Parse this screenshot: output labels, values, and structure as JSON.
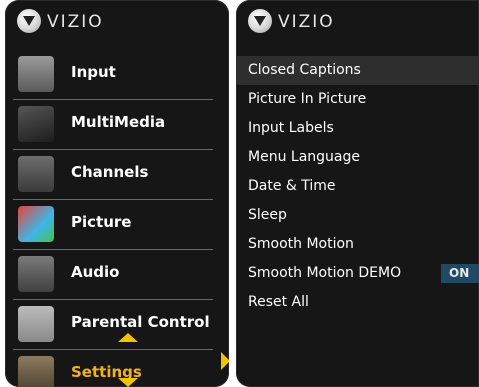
{
  "left_panel": {
    "brand": "VIZIO",
    "menu": [
      {
        "label": "Input",
        "icon": "input-icon"
      },
      {
        "label": "MultiMedia",
        "icon": "usb-stick-icon"
      },
      {
        "label": "Channels",
        "icon": "antenna-icon"
      },
      {
        "label": "Picture",
        "icon": "picture-tv-icon"
      },
      {
        "label": "Audio",
        "icon": "speaker-icon"
      },
      {
        "label": "Parental Control",
        "icon": "family-icon"
      },
      {
        "label": "Settings",
        "icon": "settings-icon"
      }
    ],
    "active_item": "Settings"
  },
  "right_panel": {
    "brand": "VIZIO",
    "items": [
      {
        "label": "Closed Captions"
      },
      {
        "label": "Picture In Picture"
      },
      {
        "label": "Input Labels"
      },
      {
        "label": "Menu Language"
      },
      {
        "label": "Date & Time"
      },
      {
        "label": "Sleep"
      },
      {
        "label": "Smooth Motion"
      },
      {
        "label": "Smooth Motion DEMO",
        "value": "ON"
      },
      {
        "label": "Reset All"
      }
    ],
    "highlighted_item": "Closed Captions"
  },
  "colors": {
    "panel_bg": "#161616",
    "active_label": "#f2b21c",
    "arrow": "#f2c400",
    "value_badge": "#1f4a66"
  }
}
